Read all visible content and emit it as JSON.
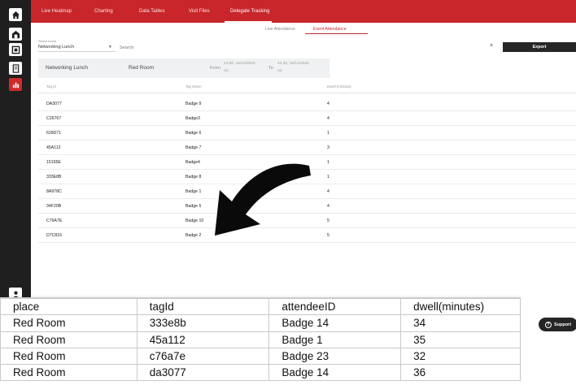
{
  "nav": {
    "items": [
      {
        "label": "Live Heatmap"
      },
      {
        "label": "Charting"
      },
      {
        "label": "Data Tables"
      },
      {
        "label": "Visit Files"
      },
      {
        "label": "Delegate Tracking"
      }
    ]
  },
  "subtabs": [
    {
      "label": "Live Attendance"
    },
    {
      "label": "Event Attendance"
    }
  ],
  "event_select": {
    "label": "Select event",
    "value": "Networking Lunch"
  },
  "search": {
    "placeholder": "Search",
    "clear": "×"
  },
  "export_label": "Export",
  "event_summary": {
    "name": "Networking Lunch",
    "room": "Red Room",
    "from_label": "From",
    "from_value": "13:00, 15/12/2022",
    "from_sub": "GB",
    "to_label": "To",
    "to_value": "14:30, 15/12/2022",
    "to_sub": "GB"
  },
  "table": {
    "headers": [
      "Tag Id",
      "Tag Name",
      "Dwell (minutes)"
    ],
    "rows": [
      {
        "tag_id": "DA3077",
        "tag_name": "Badge 9",
        "dwell": "4"
      },
      {
        "tag_id": "C26767",
        "tag_name": "Badge3",
        "dwell": "4"
      },
      {
        "tag_id": "628D71",
        "tag_name": "Badge 6",
        "dwell": "1"
      },
      {
        "tag_id": "45A112",
        "tag_name": "Badge 7",
        "dwell": "3"
      },
      {
        "tag_id": "15155E",
        "tag_name": "Badge4",
        "dwell": "1"
      },
      {
        "tag_id": "333E8B",
        "tag_name": "Badge 8",
        "dwell": "1"
      },
      {
        "tag_id": "8A978C",
        "tag_name": "Badge 1",
        "dwell": "4"
      },
      {
        "tag_id": "34F20B",
        "tag_name": "Badge 5",
        "dwell": "4"
      },
      {
        "tag_id": "C76A7E",
        "tag_name": "Badge 10",
        "dwell": "5"
      },
      {
        "tag_id": "D7C816",
        "tag_name": "Badge 2",
        "dwell": "5"
      }
    ]
  },
  "spreadsheet": {
    "headers": [
      "place",
      "tagId",
      "attendeeID",
      "dwell(minutes)"
    ],
    "rows": [
      [
        "Red Room",
        "333e8b",
        "Badge 14",
        "34"
      ],
      [
        "Red Room",
        "45a112",
        "Badge 1",
        "35"
      ],
      [
        "Red Room",
        "c76a7e",
        "Badge 23",
        "32"
      ],
      [
        "Red Room",
        "da3077",
        "Badge 14",
        "36"
      ]
    ]
  },
  "support_label": "Support",
  "icons": {
    "sidebar": [
      "home-icon",
      "building-icon",
      "layers-icon",
      "document-icon",
      "chart-icon",
      "user-settings-icon"
    ],
    "arrow": "curved-arrow-icon"
  },
  "colors": {
    "brand_red": "#c8262a",
    "sidebar_bg": "#1f1f1f",
    "button_dark": "#262626"
  }
}
